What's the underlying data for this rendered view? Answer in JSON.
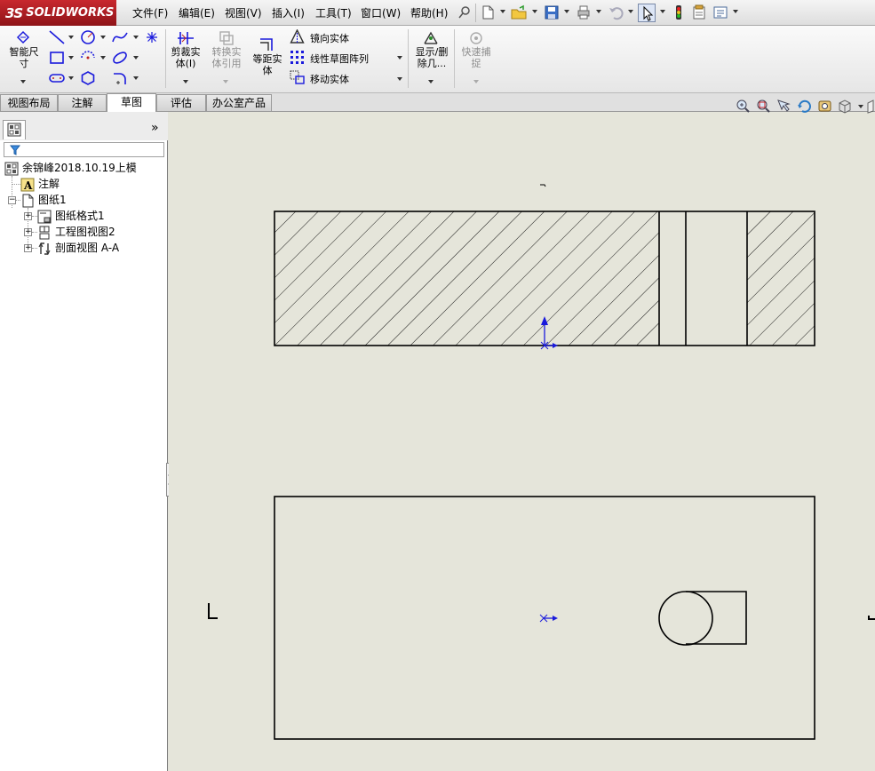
{
  "app": {
    "brand": "SOLIDWORKS",
    "brand_prefix": "3S"
  },
  "menu": [
    "文件(F)",
    "编辑(E)",
    "视图(V)",
    "插入(I)",
    "工具(T)",
    "窗口(W)",
    "帮助(H)"
  ],
  "command_manager": {
    "smart_dimension": "智能尺\n寸",
    "trim": "剪裁实\n体(I)",
    "convert": "转换实\n体引用",
    "offset": "等距实\n体",
    "mirror": "镜向实体",
    "linear_pattern": "线性草图阵列",
    "move": "移动实体",
    "show_delete": "显示/删\n除几...",
    "quick_snap": "快速捕\n捉"
  },
  "tabs": [
    "视图布局",
    "注解",
    "草图",
    "评估",
    "办公室产品"
  ],
  "active_tab": "草图",
  "feature_tree": {
    "root": "余锦峰2018.10.19上模",
    "annotations": "注解",
    "sheet": "图纸1",
    "sheet_format": "图纸格式1",
    "drawing_view": "工程图视图2",
    "section_view": "剖面视图 A-A"
  },
  "colors": {
    "accent": "#c8282e",
    "sketch_blue": "#1a1adc",
    "graphics_bg": "#e5e5da"
  },
  "icons": [
    "zoom-to-fit-icon",
    "zoom-area-icon",
    "previous-view-icon",
    "rotate-icon",
    "pan-icon",
    "view-orientation-icon"
  ]
}
